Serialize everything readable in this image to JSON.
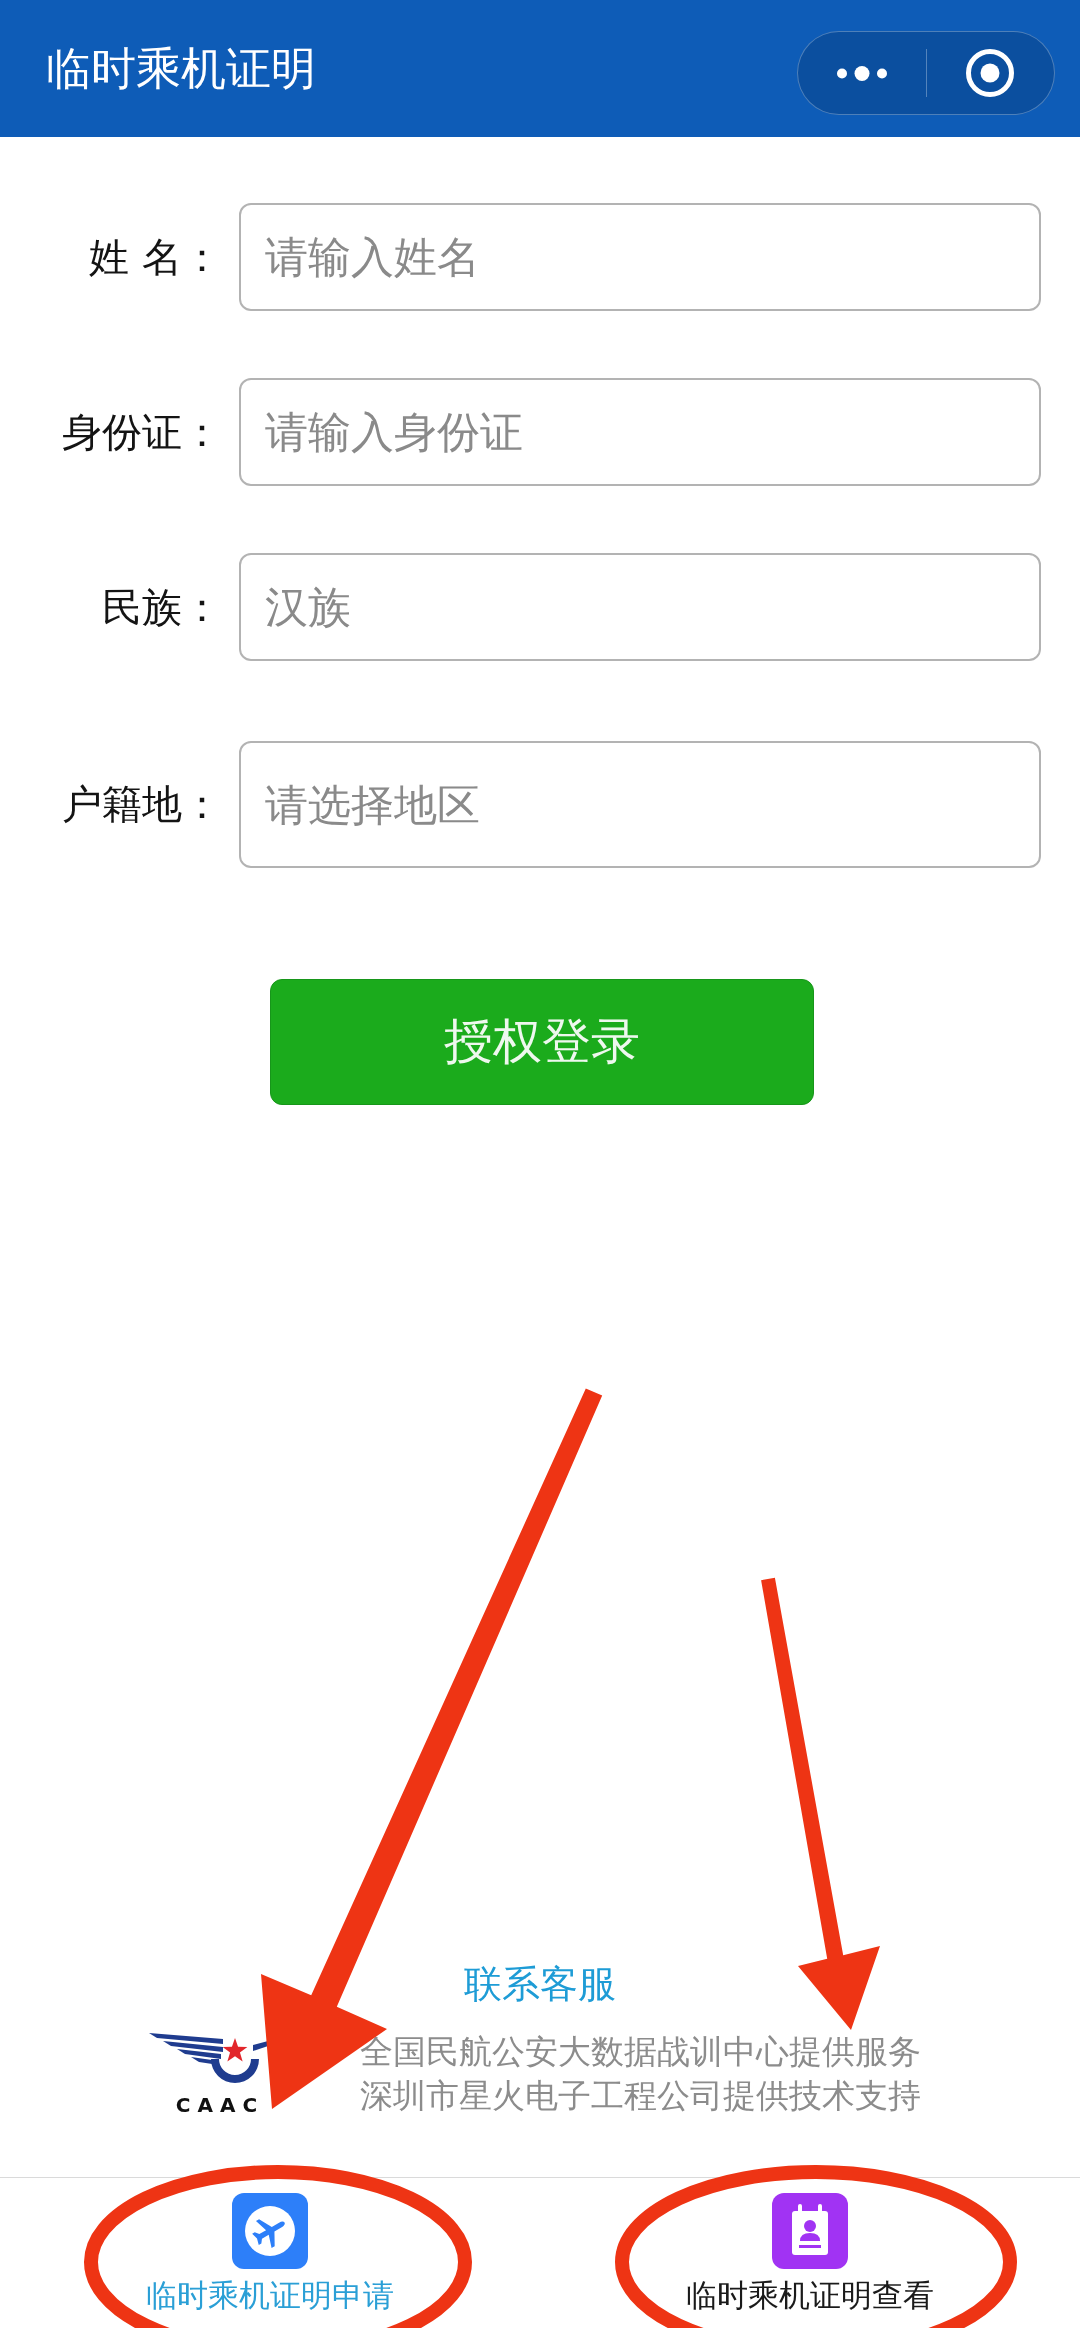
{
  "header": {
    "title": "临时乘机证明"
  },
  "form": {
    "fields": [
      {
        "label": "姓 名：",
        "placeholder": "请输入姓名",
        "kind": "input"
      },
      {
        "label": "身份证：",
        "placeholder": "请输入身份证",
        "kind": "input"
      },
      {
        "label": "民族：",
        "placeholder": "汉族",
        "kind": "input"
      },
      {
        "label": "户籍地：",
        "placeholder": "请选择地区",
        "kind": "picker"
      }
    ],
    "submit": "授权登录"
  },
  "footer": {
    "contact_link": "联系客服",
    "logo_text": "CAAC",
    "lines": [
      "全国民航公安大数据战训中心提供服务",
      "深圳市星火电子工程公司提供技术支持"
    ]
  },
  "tab_bar": {
    "tabs": [
      {
        "label": "临时乘机证明申请",
        "selected": true
      },
      {
        "label": "临时乘机证明查看",
        "selected": false
      }
    ]
  }
}
